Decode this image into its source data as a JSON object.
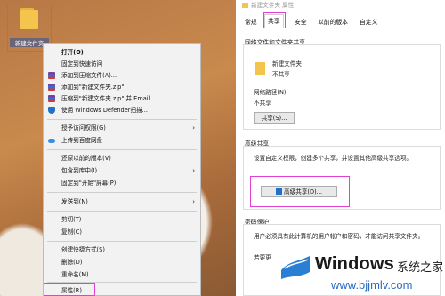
{
  "desktop": {
    "folder_label": "新建文件夹"
  },
  "context_menu": {
    "items": [
      {
        "label": "打开(O)",
        "bold": true
      },
      {
        "label": "固定到快速访问"
      },
      {
        "label": "添加到压缩文件(A)...",
        "icon": "winrar-icon"
      },
      {
        "label": "添加到\"新建文件夹.zip\"",
        "icon": "winrar-icon"
      },
      {
        "label": "压缩到\"新建文件夹.zip\" 并 Email",
        "icon": "winrar-icon"
      },
      {
        "label": "使用 Windows Defender扫描...",
        "icon": "defender-icon"
      },
      {
        "label": "授予访问权限(G)",
        "submenu": true
      },
      {
        "label": "上传到百度网盘",
        "icon": "baidu-cloud-icon"
      },
      {
        "label": "还原以前的版本(V)"
      },
      {
        "label": "包含到库中(I)",
        "submenu": true
      },
      {
        "label": "固定到\"开始\"屏幕(P)"
      },
      {
        "label": "发送到(N)",
        "submenu": true
      },
      {
        "label": "剪切(T)"
      },
      {
        "label": "复制(C)"
      },
      {
        "label": "创建快捷方式(S)"
      },
      {
        "label": "删除(D)"
      },
      {
        "label": "重命名(M)"
      },
      {
        "label": "属性(R)"
      }
    ]
  },
  "properties": {
    "title": "新建文件夹 属性",
    "tabs": [
      "常规",
      "共享",
      "安全",
      "以前的版本",
      "自定义"
    ],
    "active_tab": "共享",
    "network_group_title": "网络文件和文件夹共享",
    "folder_name": "新建文件夹",
    "share_status": "不共享",
    "network_path_label": "网络路径(N):",
    "network_path_value": "不共享",
    "share_button": "共享(S)...",
    "advanced_group_title": "高级共享",
    "advanced_desc": "设置自定义权限，创建多个共享，并设置其他高级共享选项。",
    "advanced_button": "高级共享(D)...",
    "password_group_title": "密码保护",
    "password_desc": "用户必须具有此计算机的用户帐户和密码，才能访问共享文件夹。",
    "password_more": "若要更"
  },
  "watermark": {
    "brand": "Windows",
    "cn": "系统之家",
    "url": "www.bjjmlv.com"
  }
}
